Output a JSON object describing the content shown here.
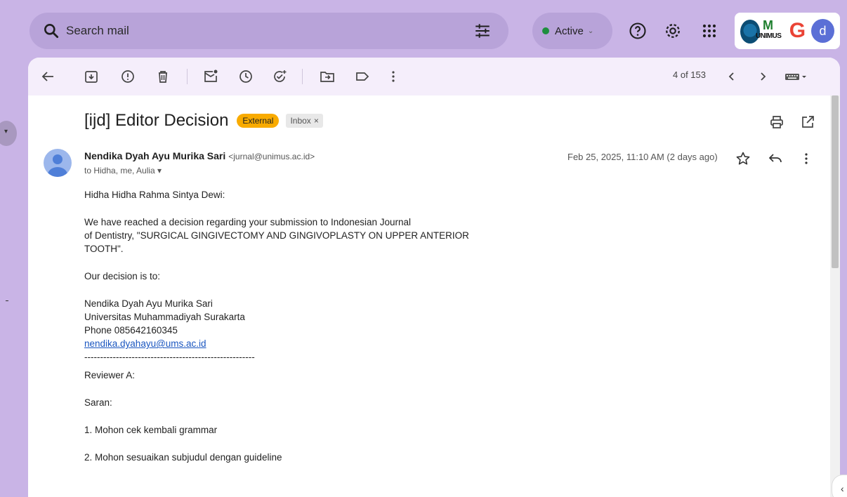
{
  "search": {
    "placeholder": "Search mail"
  },
  "status": {
    "label": "Active",
    "color": "#1e8e3e"
  },
  "account": {
    "logo_text": "UNIMUS",
    "logo_letter": "M",
    "g_letter": "G",
    "avatar_letter": "d"
  },
  "toolbar": {
    "pager": "4 of 153"
  },
  "message": {
    "subject": "[ijd] Editor Decision",
    "labels": {
      "external": "External",
      "inbox": "Inbox",
      "inbox_remove": "×"
    },
    "sender_name": "Nendika Dyah Ayu Murika Sari",
    "sender_email": "<jurnal@unimus.ac.id>",
    "to": "to Hidha, me, Aulia ▾",
    "date": "Feb 25, 2025, 11:10 AM (2 days ago)",
    "body": {
      "greeting": "Hidha Hidha Rahma Sintya Dewi:",
      "para1_line1": "We have reached a decision regarding your submission to Indonesian Journal",
      "para1_line2": "of Dentistry, \"SURGICAL GINGIVECTOMY AND GINGIVOPLASTY ON UPPER ANTERIOR",
      "para1_line3": "TOOTH\".",
      "decision": "Our decision is to:",
      "sig_name": "Nendika Dyah Ayu Murika Sari",
      "sig_univ": "Universitas Muhammadiyah Surakarta",
      "sig_phone": "Phone 085642160345",
      "sig_email": "nendika.dyahayu@ums.ac.id",
      "divider": "------------------------------------------------------",
      "reviewer": "Reviewer A:",
      "saran": "Saran:",
      "item1": "1. Mohon cek kembali grammar",
      "item2": "2. Mohon sesuaikan subjudul dengan guideline"
    }
  },
  "colors": {
    "accent": "#c9b4e6",
    "external_badge": "#f9ab00",
    "link": "#1a56c0"
  }
}
